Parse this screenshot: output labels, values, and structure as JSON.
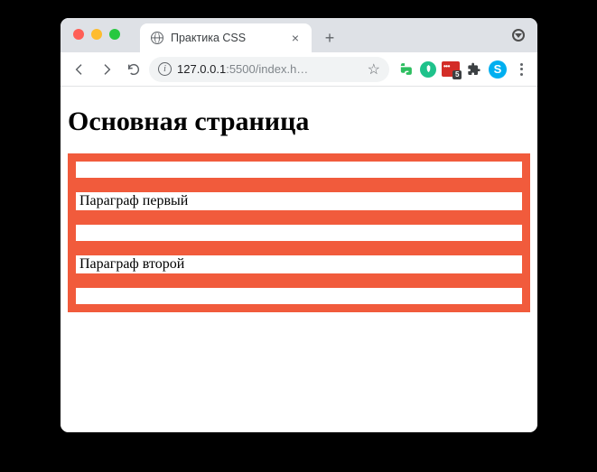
{
  "browser": {
    "tab_title": "Практика CSS",
    "url_host": "127.0.0.1",
    "url_port": ":5500",
    "url_path": "/index.h…",
    "lastpass_badge": "5"
  },
  "page": {
    "heading": "Основная страница",
    "para1": "Параграф первый",
    "para2": "Параграф второй"
  }
}
